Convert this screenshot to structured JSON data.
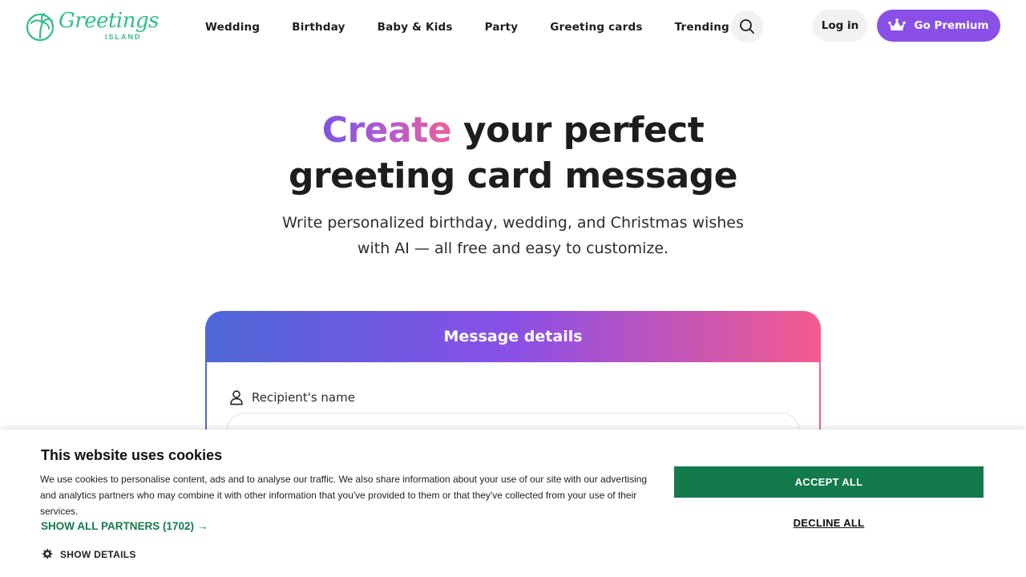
{
  "brand": {
    "name_script": "Greetings",
    "name_sub": "ISLAND",
    "color": "#2fbf85"
  },
  "nav": {
    "items": [
      "Wedding",
      "Birthday",
      "Baby & Kids",
      "Party",
      "Greeting cards",
      "Trending"
    ],
    "search_icon": "search-icon",
    "login_label": "Log in",
    "premium_label": "Go Premium",
    "premium_icon": "crown-icon",
    "premium_color": "#8a4fe6"
  },
  "hero": {
    "title_highlight": "Create",
    "title_rest_line1": " your perfect",
    "title_line2": "greeting card message",
    "subtitle_line1": "Write personalized birthday, wedding, and Christmas wishes",
    "subtitle_line2": "with AI — all free and easy to customize."
  },
  "card": {
    "header": "Message details",
    "recipient_label": "Recipient's name",
    "recipient_icon": "person-icon",
    "recipient_value": ""
  },
  "cookie_banner": {
    "title": "This website uses cookies",
    "text": "We use cookies to personalise content, ads and to analyse our traffic. We also share information about your use of our site with our advertising and analytics partners who may combine it with other information that you've provided to them or that they've collected from your use of their services.",
    "partners_link": "SHOW ALL PARTNERS (1702) →",
    "show_details": "SHOW DETAILS",
    "details_icon": "gear-icon",
    "accept_label": "ACCEPT ALL",
    "decline_label": "DECLINE ALL",
    "accent_color": "#127a4b"
  }
}
